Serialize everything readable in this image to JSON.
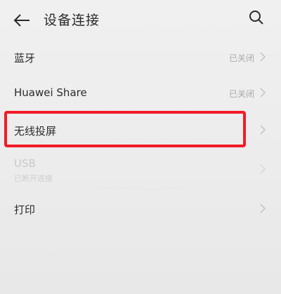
{
  "header": {
    "title": "设备连接",
    "back_icon": "back-arrow-icon",
    "search_icon": "search-icon"
  },
  "items": [
    {
      "label": "蓝牙",
      "status": "已关闭"
    },
    {
      "label": "Huawei Share",
      "status": "已关闭"
    },
    {
      "label": "无线投屏",
      "status": ""
    },
    {
      "label": "USB",
      "sublabel": "已断开连接",
      "status": ""
    },
    {
      "label": "打印",
      "status": ""
    }
  ],
  "colors": {
    "highlight": "#f21b27",
    "text_primary": "#2b2b2b",
    "text_secondary": "#a9a9a9",
    "text_disabled": "#c9c9c9"
  }
}
